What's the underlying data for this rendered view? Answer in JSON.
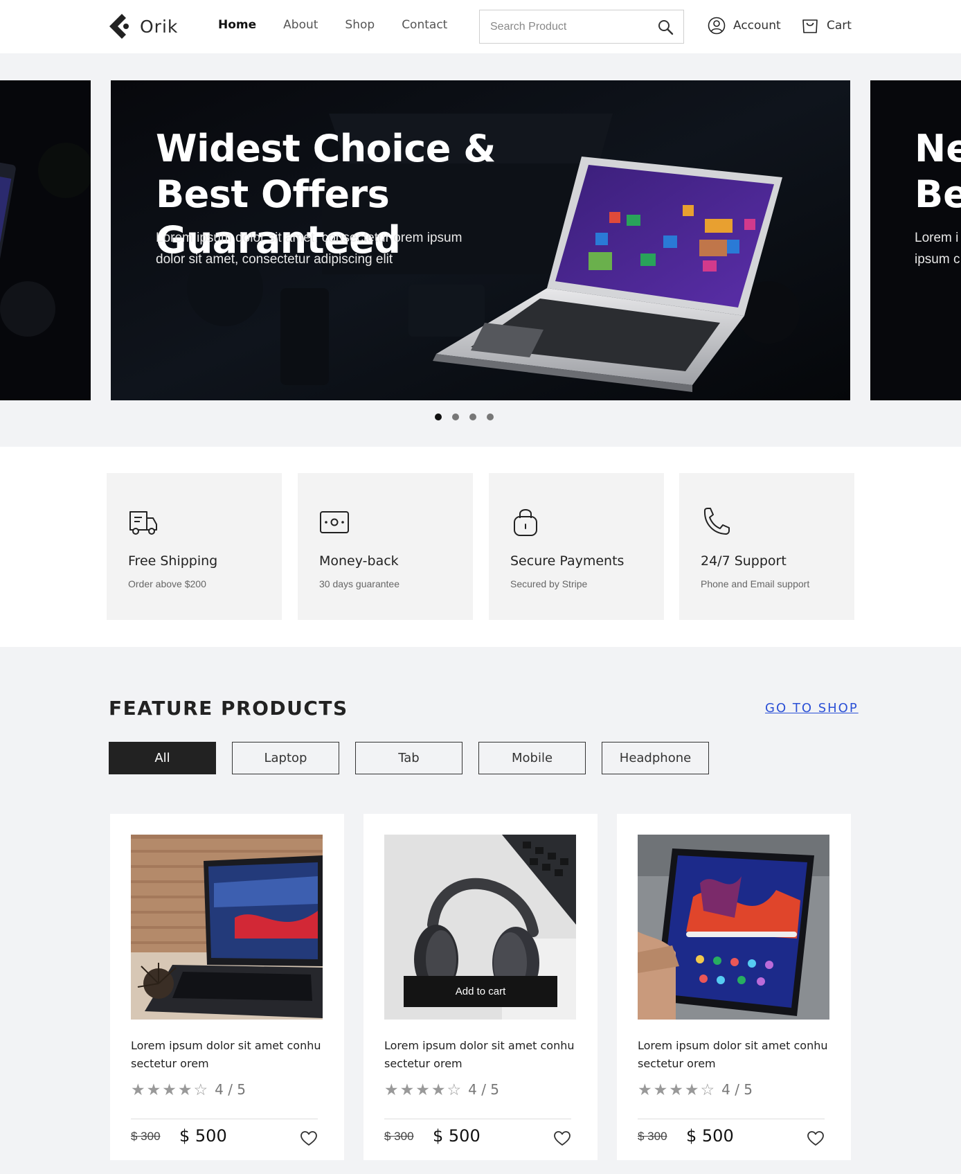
{
  "header": {
    "brand": "Orik",
    "nav": [
      "Home",
      "About",
      "Shop",
      "Contact"
    ],
    "search_placeholder": "Search Product",
    "account_label": "Account",
    "cart_label": "Cart"
  },
  "hero": {
    "title": "Widest Choice & Best Offers Guaranteed",
    "text": "Lorem ipsum dolor sit amet, consectetur orem ipsum dolor sit amet, consectetur adipiscing elit",
    "next_title": "Ne\nBes",
    "next_text": "Lorem i\nipsum c",
    "slide_count": 4,
    "active_slide": 1
  },
  "features": [
    {
      "icon": "truck-icon",
      "title": "Free Shipping",
      "sub": "Order above $200"
    },
    {
      "icon": "money-icon",
      "title": "Money-back",
      "sub": "30 days guarantee"
    },
    {
      "icon": "lock-icon",
      "title": "Secure Payments",
      "sub": "Secured by Stripe"
    },
    {
      "icon": "phone-icon",
      "title": "24/7 Support",
      "sub": "Phone and Email support"
    }
  ],
  "products": {
    "title": "FEATURE PRODUCTS",
    "go_shop": "GO TO SHOP",
    "filters": [
      "All",
      "Laptop",
      "Tab",
      "Mobile",
      "Headphone"
    ],
    "active_filter": "All",
    "add_to_cart": "Add to cart",
    "items": [
      {
        "name": "Lorem ipsum dolor sit amet conhu sectetur orem",
        "rating": 4,
        "rating_text": "4 / 5",
        "old_price": "$ 300",
        "price": "$ 500",
        "image": "laptop"
      },
      {
        "name": "Lorem ipsum dolor sit amet conhu sectetur orem",
        "rating": 4,
        "rating_text": "4 / 5",
        "old_price": "$ 300",
        "price": "$ 500",
        "image": "headphones"
      },
      {
        "name": "Lorem ipsum dolor sit amet conhu sectetur orem",
        "rating": 4,
        "rating_text": "4 / 5",
        "old_price": "$ 300",
        "price": "$ 500",
        "image": "tablet"
      }
    ]
  },
  "colors": {
    "accent_link": "#2b50d6",
    "dark": "#222222",
    "background": "#f2f3f5"
  }
}
